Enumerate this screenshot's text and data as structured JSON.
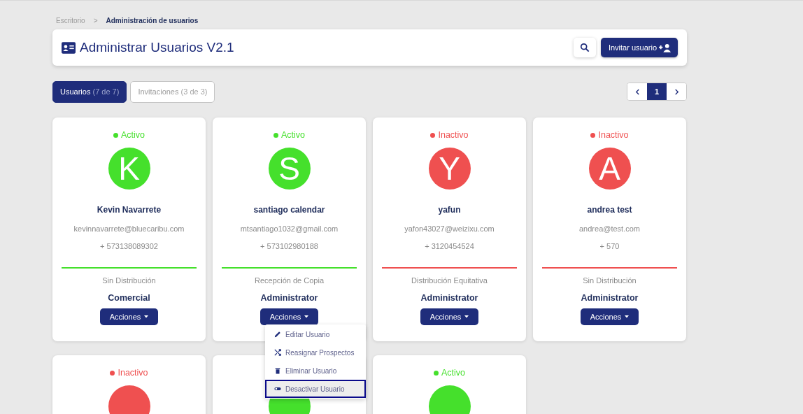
{
  "breadcrumb": {
    "items": [
      {
        "label": "Escritorio",
        "current": false
      },
      {
        "label": "Administración de usuarios",
        "current": true
      }
    ],
    "separator": ">"
  },
  "header": {
    "title": "Administrar Usuarios V2.1",
    "invite_button": "Invitar usuario"
  },
  "tabs": [
    {
      "label": "Usuarios",
      "count": "(7 de 7)",
      "selected": true
    },
    {
      "label": "Invitaciones",
      "count": "(3 de 3)",
      "selected": false
    }
  ],
  "pagination": {
    "pages": [
      {
        "label": "1",
        "selected": true
      }
    ]
  },
  "users": [
    {
      "status": "Activo",
      "active": true,
      "initial": "K",
      "name": "Kevin Navarrete",
      "email": "kevinnavarrete@bluecaribu.com",
      "phone": "+ 573138089302",
      "distribution": "Sin Distribución",
      "role": "Comercial",
      "button": "Acciones"
    },
    {
      "status": "Activo",
      "active": true,
      "initial": "S",
      "name": "santiago calendar",
      "email": "mtsantiago1032@gmail.com",
      "phone": "+ 573102980188",
      "distribution": "Recepción de Copia",
      "role": "Administrator",
      "button": "Acciones"
    },
    {
      "status": "Inactivo",
      "active": false,
      "initial": "Y",
      "name": "yafun",
      "email": "yafon43027@weizixu.com",
      "phone": "+ 3120454524",
      "distribution": "Distribución Equitativa",
      "role": "Administrator",
      "button": "Acciones"
    },
    {
      "status": "Inactivo",
      "active": false,
      "initial": "A",
      "name": "andrea test",
      "email": "andrea@test.com",
      "phone": "+ 570",
      "distribution": "Sin Distribución",
      "role": "Administrator",
      "button": "Acciones"
    },
    {
      "status": "Inactivo",
      "active": false
    },
    {
      "active": true
    },
    {
      "status": "Activo",
      "active": true
    }
  ],
  "actions_menu": {
    "items": [
      {
        "kind": "edit",
        "label": "Editar Usuario",
        "selected": false
      },
      {
        "kind": "reassign",
        "label": "Reasignar Prospectos",
        "selected": false
      },
      {
        "kind": "delete",
        "label": "Eliminar Usuario",
        "selected": false
      },
      {
        "kind": "deactivate",
        "label": "Desactivar Usuario",
        "selected": true
      }
    ]
  }
}
